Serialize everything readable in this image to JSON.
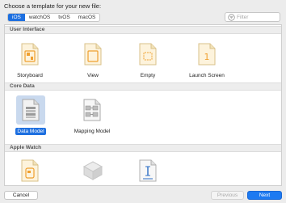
{
  "title": "Choose a template for your new file:",
  "platform_tabs": [
    {
      "label": "iOS",
      "active": true
    },
    {
      "label": "watchOS",
      "active": false
    },
    {
      "label": "tvOS",
      "active": false
    },
    {
      "label": "macOS",
      "active": false
    }
  ],
  "filter": {
    "placeholder": "Filter",
    "icon": "filter-icon"
  },
  "sections": [
    {
      "label": "User Interface"
    },
    {
      "label": "Core Data"
    },
    {
      "label": "Apple Watch"
    }
  ],
  "templates": {
    "user_interface": [
      {
        "label": "Storyboard",
        "icon": "storyboard-file-icon"
      },
      {
        "label": "View",
        "icon": "view-file-icon"
      },
      {
        "label": "Empty",
        "icon": "empty-file-icon"
      },
      {
        "label": "Launch Screen",
        "icon": "launch-screen-file-icon"
      }
    ],
    "core_data": [
      {
        "label": "Data Model",
        "icon": "data-model-file-icon",
        "selected": true
      },
      {
        "label": "Mapping Model",
        "icon": "mapping-model-file-icon"
      }
    ],
    "apple_watch": [
      {
        "label": "",
        "icon": "watch-storyboard-file-icon"
      },
      {
        "label": "",
        "icon": "watch-cube-icon"
      },
      {
        "label": "",
        "icon": "watch-strings-file-icon"
      }
    ]
  },
  "buttons": {
    "cancel": "Cancel",
    "previous": "Previous",
    "next": "Next"
  },
  "colors": {
    "accent": "#1d6fe0",
    "file_orange": "#f0a030"
  }
}
